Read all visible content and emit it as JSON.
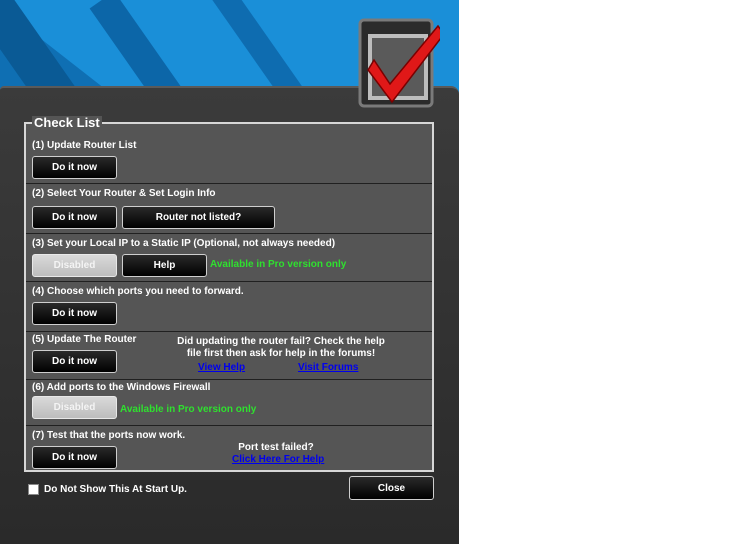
{
  "checklist": {
    "title": "Check List",
    "steps": [
      {
        "title": "(1) Update Router List",
        "buttons": [
          "Do it now"
        ]
      },
      {
        "title": "(2) Select Your Router & Set Login Info",
        "buttons": [
          "Do it now",
          "Router not listed?"
        ]
      },
      {
        "title": "(3) Set your Local IP to a Static IP (Optional, not always needed)",
        "buttons": [
          "Disabled",
          "Help"
        ],
        "note": "Available in Pro version only"
      },
      {
        "title": "(4) Choose which ports you need to forward.",
        "buttons": [
          "Do it now"
        ]
      },
      {
        "title": "(5) Update The Router",
        "buttons": [
          "Do it now"
        ],
        "note_line1": "Did updating the router fail? Check the help",
        "note_line2": "file first then ask for help in the forums!",
        "link1": "View Help",
        "link2": "Visit Forums"
      },
      {
        "title": "(6) Add ports to the Windows Firewall",
        "buttons": [
          "Disabled"
        ],
        "note": "Available in Pro version only"
      },
      {
        "title": "(7) Test that the ports now work.",
        "buttons": [
          "Do it now"
        ],
        "note": "Port test failed?",
        "link": "Click Here For Help"
      }
    ]
  },
  "footer": {
    "checkbox_label": "Do Not Show This At Start Up.",
    "checkbox_checked": false,
    "close_label": "Close"
  },
  "colors": {
    "background_blue": "#1a8fd8",
    "panel": "#3b3b3b",
    "checklist_bg": "#555555",
    "pro_note_green": "#2fe02f",
    "link_blue": "#0000ee",
    "logo_check_red": "#e01818"
  },
  "icons": {
    "logo": "checkbox-checkmark-icon"
  }
}
